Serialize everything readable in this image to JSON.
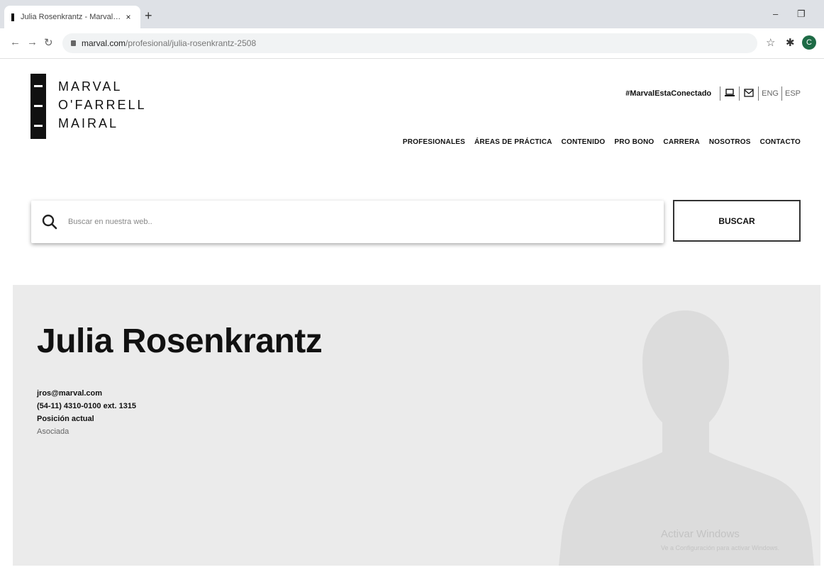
{
  "browser": {
    "tab_title": "Julia Rosenkrantz - Marval, O'Farr",
    "tab_close": "×",
    "new_tab": "+",
    "url_domain": "marval.com",
    "url_path": "/profesional/julia-rosenkrantz-2508",
    "avatar_letter": "C",
    "icons": [
      "back-icon",
      "forward-icon",
      "reload-icon",
      "lock-icon",
      "star-icon",
      "extensions-icon",
      "minimize-icon",
      "maximize-icon"
    ]
  },
  "header": {
    "logo_lines": [
      "MARVAL",
      "O'FARRELL",
      "MAIRAL"
    ],
    "hashtag": "#MarvalEstaConectado",
    "lang_eng": "ENG",
    "lang_esp": "ESP",
    "nav": [
      "PROFESIONALES",
      "ÁREAS DE PRÁCTICA",
      "CONTENIDO",
      "PRO BONO",
      "CARRERA",
      "NOSOTROS",
      "CONTACTO"
    ]
  },
  "search": {
    "placeholder": "Buscar en nuestra web..",
    "button_label": "BUSCAR"
  },
  "profile": {
    "name": "Julia Rosenkrantz",
    "email": "jros@marval.com",
    "phone": "(54-11) 4310-0100 ext. 1315",
    "position_label": "Posición actual",
    "position_value": "Asociada"
  },
  "watermark": {
    "line1": "Activar Windows",
    "line2": "Ve a Configuración para activar Windows."
  },
  "colors": {
    "profile_bg": "#ebebeb",
    "avatar_bg": "#1e6b46",
    "text": "#111111"
  }
}
